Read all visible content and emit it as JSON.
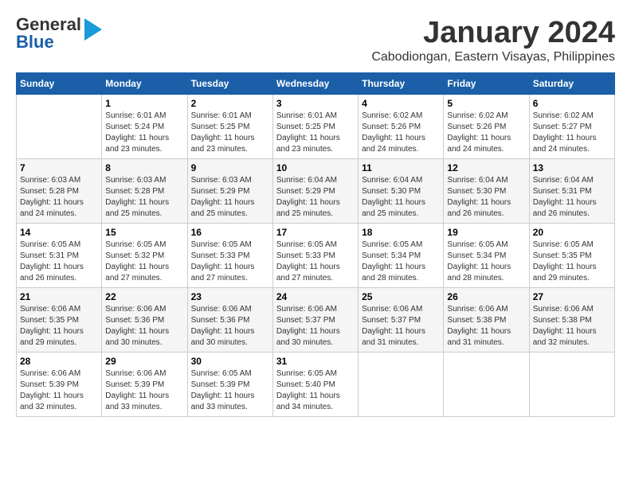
{
  "header": {
    "logo_general": "General",
    "logo_blue": "Blue",
    "month": "January 2024",
    "location": "Cabodiongan, Eastern Visayas, Philippines"
  },
  "weekdays": [
    "Sunday",
    "Monday",
    "Tuesday",
    "Wednesday",
    "Thursday",
    "Friday",
    "Saturday"
  ],
  "weeks": [
    [
      {
        "day": "",
        "info": ""
      },
      {
        "day": "1",
        "info": "Sunrise: 6:01 AM\nSunset: 5:24 PM\nDaylight: 11 hours\nand 23 minutes."
      },
      {
        "day": "2",
        "info": "Sunrise: 6:01 AM\nSunset: 5:25 PM\nDaylight: 11 hours\nand 23 minutes."
      },
      {
        "day": "3",
        "info": "Sunrise: 6:01 AM\nSunset: 5:25 PM\nDaylight: 11 hours\nand 23 minutes."
      },
      {
        "day": "4",
        "info": "Sunrise: 6:02 AM\nSunset: 5:26 PM\nDaylight: 11 hours\nand 24 minutes."
      },
      {
        "day": "5",
        "info": "Sunrise: 6:02 AM\nSunset: 5:26 PM\nDaylight: 11 hours\nand 24 minutes."
      },
      {
        "day": "6",
        "info": "Sunrise: 6:02 AM\nSunset: 5:27 PM\nDaylight: 11 hours\nand 24 minutes."
      }
    ],
    [
      {
        "day": "7",
        "info": "Sunrise: 6:03 AM\nSunset: 5:28 PM\nDaylight: 11 hours\nand 24 minutes."
      },
      {
        "day": "8",
        "info": "Sunrise: 6:03 AM\nSunset: 5:28 PM\nDaylight: 11 hours\nand 25 minutes."
      },
      {
        "day": "9",
        "info": "Sunrise: 6:03 AM\nSunset: 5:29 PM\nDaylight: 11 hours\nand 25 minutes."
      },
      {
        "day": "10",
        "info": "Sunrise: 6:04 AM\nSunset: 5:29 PM\nDaylight: 11 hours\nand 25 minutes."
      },
      {
        "day": "11",
        "info": "Sunrise: 6:04 AM\nSunset: 5:30 PM\nDaylight: 11 hours\nand 25 minutes."
      },
      {
        "day": "12",
        "info": "Sunrise: 6:04 AM\nSunset: 5:30 PM\nDaylight: 11 hours\nand 26 minutes."
      },
      {
        "day": "13",
        "info": "Sunrise: 6:04 AM\nSunset: 5:31 PM\nDaylight: 11 hours\nand 26 minutes."
      }
    ],
    [
      {
        "day": "14",
        "info": "Sunrise: 6:05 AM\nSunset: 5:31 PM\nDaylight: 11 hours\nand 26 minutes."
      },
      {
        "day": "15",
        "info": "Sunrise: 6:05 AM\nSunset: 5:32 PM\nDaylight: 11 hours\nand 27 minutes."
      },
      {
        "day": "16",
        "info": "Sunrise: 6:05 AM\nSunset: 5:33 PM\nDaylight: 11 hours\nand 27 minutes."
      },
      {
        "day": "17",
        "info": "Sunrise: 6:05 AM\nSunset: 5:33 PM\nDaylight: 11 hours\nand 27 minutes."
      },
      {
        "day": "18",
        "info": "Sunrise: 6:05 AM\nSunset: 5:34 PM\nDaylight: 11 hours\nand 28 minutes."
      },
      {
        "day": "19",
        "info": "Sunrise: 6:05 AM\nSunset: 5:34 PM\nDaylight: 11 hours\nand 28 minutes."
      },
      {
        "day": "20",
        "info": "Sunrise: 6:05 AM\nSunset: 5:35 PM\nDaylight: 11 hours\nand 29 minutes."
      }
    ],
    [
      {
        "day": "21",
        "info": "Sunrise: 6:06 AM\nSunset: 5:35 PM\nDaylight: 11 hours\nand 29 minutes."
      },
      {
        "day": "22",
        "info": "Sunrise: 6:06 AM\nSunset: 5:36 PM\nDaylight: 11 hours\nand 30 minutes."
      },
      {
        "day": "23",
        "info": "Sunrise: 6:06 AM\nSunset: 5:36 PM\nDaylight: 11 hours\nand 30 minutes."
      },
      {
        "day": "24",
        "info": "Sunrise: 6:06 AM\nSunset: 5:37 PM\nDaylight: 11 hours\nand 30 minutes."
      },
      {
        "day": "25",
        "info": "Sunrise: 6:06 AM\nSunset: 5:37 PM\nDaylight: 11 hours\nand 31 minutes."
      },
      {
        "day": "26",
        "info": "Sunrise: 6:06 AM\nSunset: 5:38 PM\nDaylight: 11 hours\nand 31 minutes."
      },
      {
        "day": "27",
        "info": "Sunrise: 6:06 AM\nSunset: 5:38 PM\nDaylight: 11 hours\nand 32 minutes."
      }
    ],
    [
      {
        "day": "28",
        "info": "Sunrise: 6:06 AM\nSunset: 5:39 PM\nDaylight: 11 hours\nand 32 minutes."
      },
      {
        "day": "29",
        "info": "Sunrise: 6:06 AM\nSunset: 5:39 PM\nDaylight: 11 hours\nand 33 minutes."
      },
      {
        "day": "30",
        "info": "Sunrise: 6:05 AM\nSunset: 5:39 PM\nDaylight: 11 hours\nand 33 minutes."
      },
      {
        "day": "31",
        "info": "Sunrise: 6:05 AM\nSunset: 5:40 PM\nDaylight: 11 hours\nand 34 minutes."
      },
      {
        "day": "",
        "info": ""
      },
      {
        "day": "",
        "info": ""
      },
      {
        "day": "",
        "info": ""
      }
    ]
  ]
}
